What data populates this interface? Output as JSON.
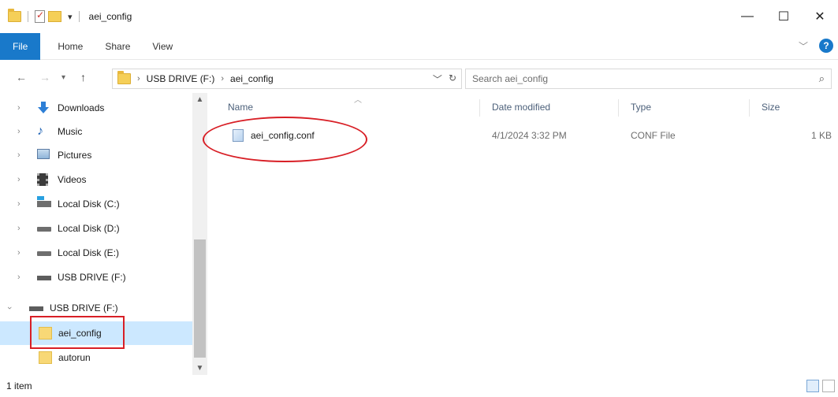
{
  "window": {
    "title": "aei_config",
    "controls": {
      "minimize": "—",
      "maximize": "☐",
      "close": "✕"
    }
  },
  "ribbon": {
    "tabs": [
      "File",
      "Home",
      "Share",
      "View"
    ],
    "help": "?"
  },
  "address": {
    "crumbs": [
      "USB DRIVE (F:)",
      "aei_config"
    ],
    "search_placeholder": "Search aei_config"
  },
  "nav": {
    "items": [
      {
        "label": "Downloads",
        "icon": "downloads-icon",
        "expandable": true
      },
      {
        "label": "Music",
        "icon": "music-icon",
        "expandable": true
      },
      {
        "label": "Pictures",
        "icon": "pictures-icon",
        "expandable": true
      },
      {
        "label": "Videos",
        "icon": "videos-icon",
        "expandable": true
      },
      {
        "label": "Local Disk (C:)",
        "icon": "system-drive-icon",
        "expandable": true
      },
      {
        "label": "Local Disk (D:)",
        "icon": "drive-icon",
        "expandable": true
      },
      {
        "label": "Local Disk (E:)",
        "icon": "drive-icon",
        "expandable": true
      },
      {
        "label": "USB DRIVE (F:)",
        "icon": "usb-drive-icon",
        "expandable": true
      },
      {
        "label": "USB DRIVE (F:)",
        "icon": "usb-drive-icon",
        "expanded": true
      },
      {
        "label": "aei_config",
        "icon": "folder-icon",
        "selected": true
      },
      {
        "label": "autorun",
        "icon": "folder-icon"
      }
    ]
  },
  "files": {
    "columns": [
      "Name",
      "Date modified",
      "Type",
      "Size"
    ],
    "rows": [
      {
        "name": "aei_config.conf",
        "date": "4/1/2024 3:32 PM",
        "type": "CONF File",
        "size": "1 KB"
      }
    ]
  },
  "status": {
    "text": "1 item"
  },
  "colors": {
    "accent": "#1979ca",
    "selection": "#cce8ff",
    "annotation": "#d81f26"
  }
}
